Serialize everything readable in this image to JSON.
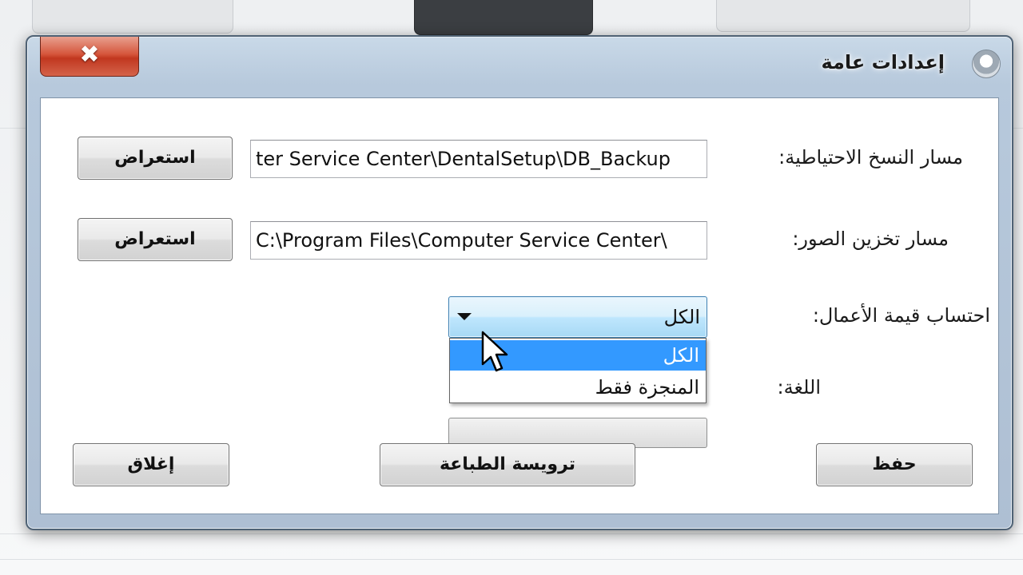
{
  "window": {
    "title": "إعدادات عامة",
    "close_glyph": "✖"
  },
  "form": {
    "backup_path": {
      "label": "مسار النسخ الاحتياطية:",
      "value": "ter Service Center\\DentalSetup\\DB_Backup",
      "browse_label": "استعراض"
    },
    "images_path": {
      "label": "مسار تخزين الصور:",
      "value": "C:\\Program Files\\Computer Service Center\\",
      "browse_label": "استعراض"
    },
    "works_value": {
      "label": "احتساب قيمة الأعمال:",
      "selected": "الكل",
      "options": [
        "الكل",
        "المنجزة فقط"
      ]
    },
    "language": {
      "label": "اللغة:"
    }
  },
  "buttons": {
    "save": "حفظ",
    "print_header": "ترويسة الطباعة",
    "close": "إغلاق"
  },
  "icons": {
    "app": "tooth-icon",
    "close": "close-icon",
    "dropdown": "chevron-down-icon",
    "cursor": "mouse-pointer-icon"
  },
  "colors": {
    "selection": "#3399ff",
    "close_button": "#c1371f",
    "combo_focus": "#a7d9f5"
  }
}
